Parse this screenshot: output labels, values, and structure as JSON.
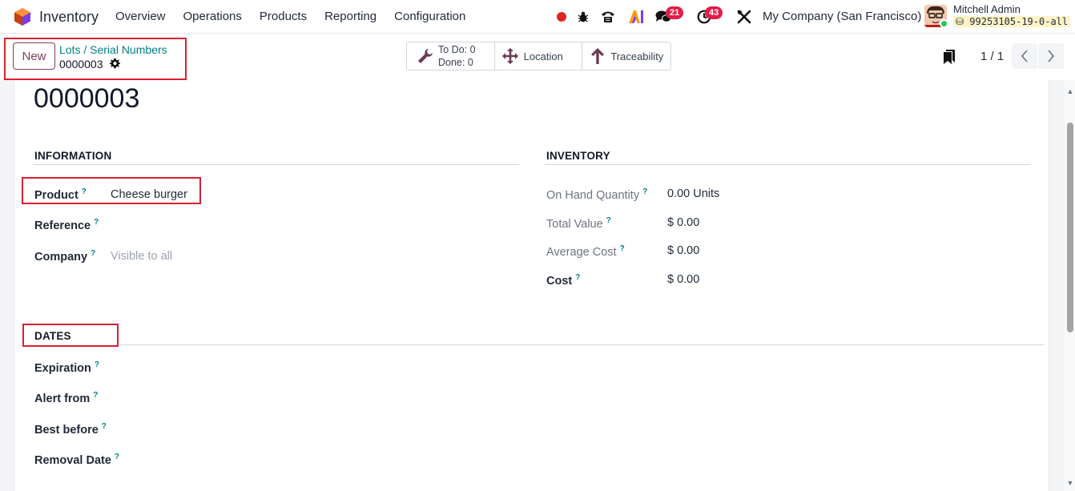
{
  "app": {
    "name": "Inventory"
  },
  "menu": [
    {
      "label": "Overview"
    },
    {
      "label": "Operations"
    },
    {
      "label": "Products"
    },
    {
      "label": "Reporting"
    },
    {
      "label": "Configuration"
    }
  ],
  "systray": {
    "messages_count": "21",
    "activities_count": "43",
    "company": "My Company (San Francisco)",
    "user_name": "Mitchell Admin",
    "db_name": "99253105-19-0-all"
  },
  "control": {
    "new_label": "New",
    "breadcrumb_parent": "Lots / Serial Numbers",
    "breadcrumb_current": "0000003",
    "smart_buttons": {
      "todo": "To Do: 0",
      "done": "Done: 0",
      "location": "Location",
      "traceability": "Traceability"
    },
    "pager": "1 / 1"
  },
  "form": {
    "record_name": "0000003",
    "information": {
      "title": "INFORMATION",
      "product_label": "Product",
      "product_value": "Cheese burger",
      "reference_label": "Reference",
      "company_label": "Company",
      "company_placeholder": "Visible to all"
    },
    "inventory": {
      "title": "INVENTORY",
      "on_hand_label": "On Hand Quantity",
      "on_hand_value": "0.00 Units",
      "total_value_label": "Total Value",
      "total_value_value": "$ 0.00",
      "avg_cost_label": "Average Cost",
      "avg_cost_value": "$ 0.00",
      "cost_label": "Cost",
      "cost_value": "$ 0.00"
    },
    "dates": {
      "title": "DATES",
      "expiration_label": "Expiration",
      "alert_label": "Alert from",
      "best_before_label": "Best before",
      "removal_label": "Removal Date"
    },
    "help_marker": "?"
  },
  "colors": {
    "primary": "#7b3f5f",
    "link": "#017e84",
    "highlight": "#d92030",
    "badge": "#e11d48"
  }
}
